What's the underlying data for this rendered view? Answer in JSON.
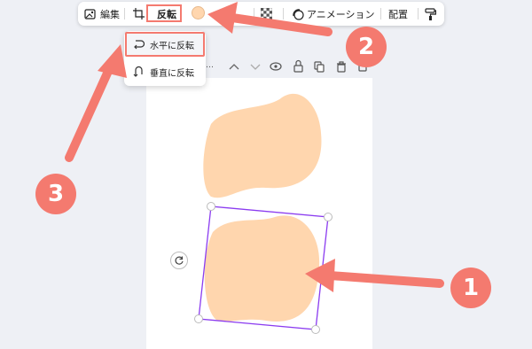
{
  "toolbar": {
    "edit_label": "編集",
    "flip_label": "反転",
    "animation_label": "アニメーション",
    "arrange_label": "配置",
    "selected_color": "#ffd6ae"
  },
  "flip_menu": {
    "horizontal_label": "水平に反転",
    "vertical_label": "垂直に反転"
  },
  "mini_toolbar": {
    "more_label": "…"
  },
  "callouts": {
    "one": "1",
    "two": "2",
    "three": "3"
  },
  "colors": {
    "annotation": "#f47a6f",
    "shape_fill": "#ffd6ae",
    "selection": "#8b3cf0",
    "background": "#eef0f5"
  }
}
